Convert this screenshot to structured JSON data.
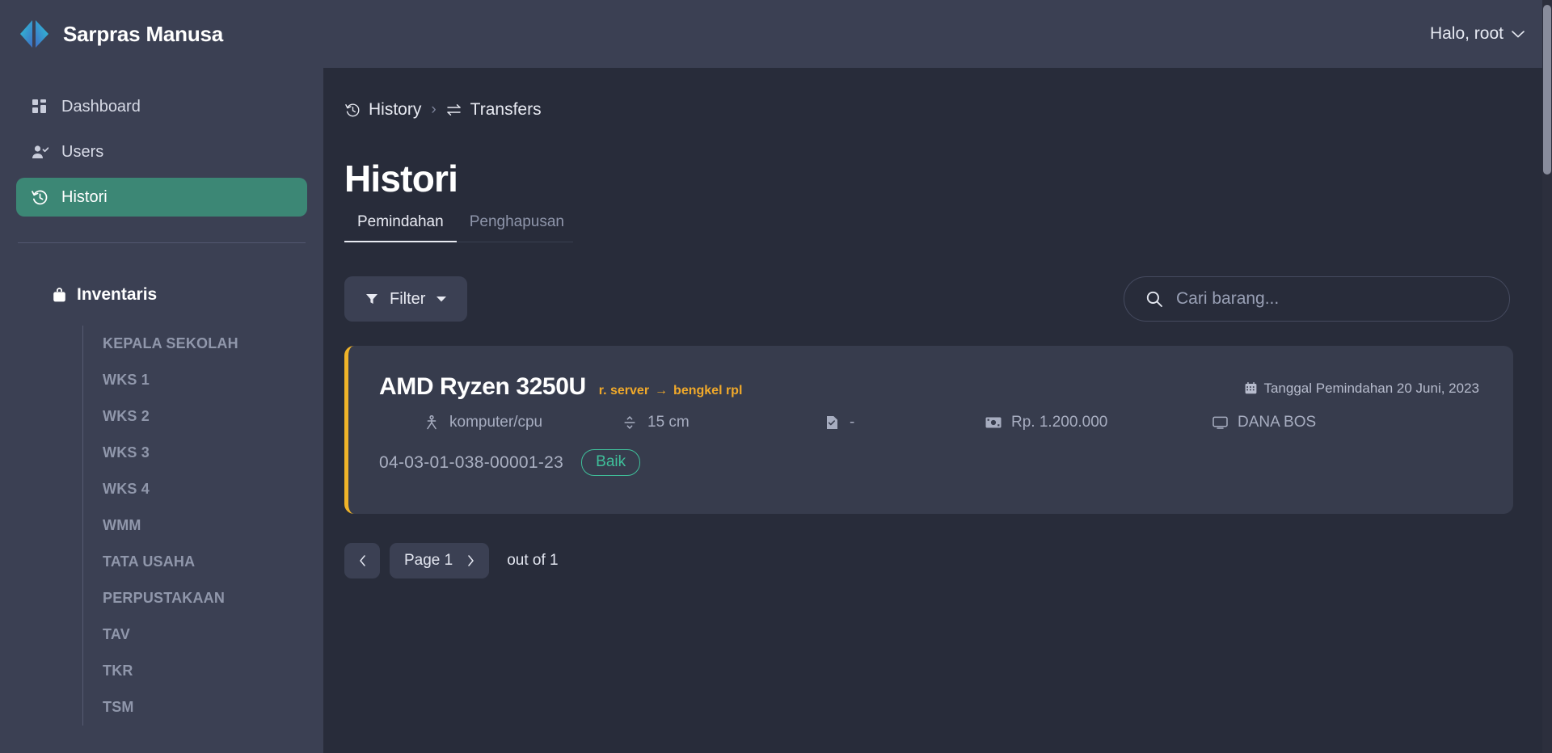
{
  "topbar": {
    "brand_name": "Sarpras Manusa",
    "logo_icon": "code-brackets-logo",
    "user_greeting": "Halo, root",
    "chevron_icon": "chevron-down-icon"
  },
  "sidebar": {
    "items": [
      {
        "label": "Dashboard",
        "icon": "dashboard-grid-icon",
        "active": false
      },
      {
        "label": "Users",
        "icon": "user-check-icon",
        "active": false
      },
      {
        "label": "Histori",
        "icon": "history-clock-icon",
        "active": true
      }
    ],
    "group": {
      "label": "Inventaris",
      "icon": "bag-icon",
      "items": [
        "KEPALA SEKOLAH",
        "WKS 1",
        "WKS 2",
        "WKS 3",
        "WKS 4",
        "WMM",
        "TATA USAHA",
        "PERPUSTAKAAN",
        "TAV",
        "TKR",
        "TSM"
      ]
    }
  },
  "breadcrumb": {
    "items": [
      {
        "label": "History",
        "icon": "history-clock-icon"
      },
      {
        "label": "Transfers",
        "icon": "transfer-arrows-icon"
      }
    ],
    "separator": "›"
  },
  "page": {
    "title": "Histori",
    "tabs": [
      {
        "label": "Pemindahan",
        "active": true
      },
      {
        "label": "Penghapusan",
        "active": false
      }
    ]
  },
  "toolbar": {
    "filter_label": "Filter",
    "filter_icon": "funnel-icon",
    "filter_caret_icon": "caret-down-icon",
    "search_icon": "search-icon",
    "search_placeholder": "Cari barang...",
    "search_value": ""
  },
  "records": [
    {
      "title": "AMD Ryzen 3250U",
      "transfer_from": "r. server",
      "transfer_arrow": "→",
      "transfer_to": "bengkel rpl",
      "date_label": "Tanggal Pemindahan 20 Juni, 2023",
      "date_icon": "calendar-icon",
      "category": "komputer/cpu",
      "category_icon": "category-icon",
      "size": "15 cm",
      "size_icon": "resize-icon",
      "document": "-",
      "document_icon": "document-check-icon",
      "price": "Rp. 1.200.000",
      "price_icon": "money-icon",
      "fund_source": "DANA BOS",
      "fund_icon": "monitor-icon",
      "serial": "04-03-01-038-00001-23",
      "condition": "Baik",
      "accent_color": "#f0b429",
      "condition_color": "#3fbf9a"
    }
  ],
  "pagination": {
    "prev_icon": "chevron-left-icon",
    "next_icon": "chevron-right-icon",
    "page_label": "Page 1",
    "out_of_label": "out of 1"
  }
}
